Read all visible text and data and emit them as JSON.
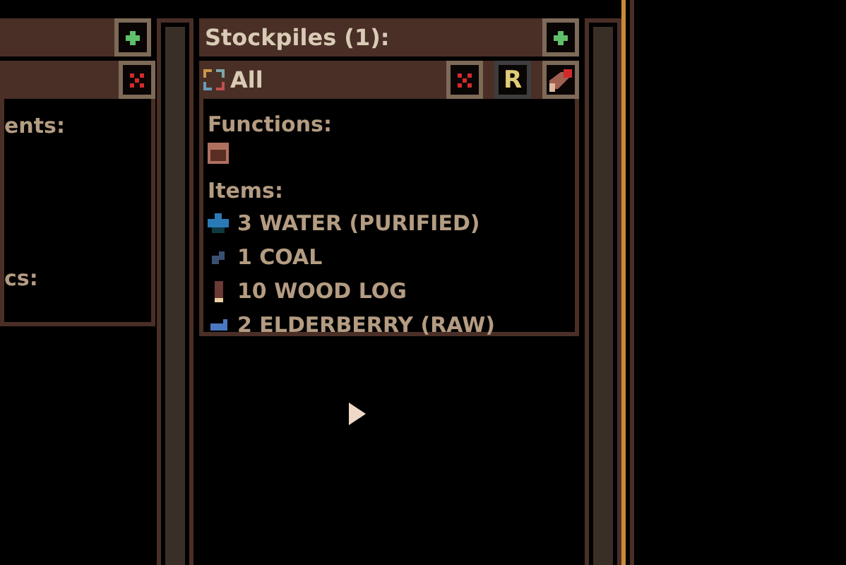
{
  "left_panel": {
    "header_button": {
      "kind": "add"
    },
    "sub_button": {
      "kind": "delete"
    },
    "labels": [
      "ents:",
      "cs:"
    ]
  },
  "stockpiles": {
    "title": "Stockpiles (1):",
    "header_button": {
      "kind": "add"
    },
    "stockpile": {
      "name": "All",
      "buttons": [
        {
          "kind": "delete"
        },
        {
          "kind": "rename",
          "label": "R"
        },
        {
          "kind": "paint"
        }
      ],
      "functions_label": "Functions:",
      "items_label": "Items:",
      "items": [
        {
          "kind": "water",
          "text": "3 WATER (PURIFIED)"
        },
        {
          "kind": "coal",
          "text": "1 COAL"
        },
        {
          "kind": "log",
          "text": "10 WOOD LOG"
        },
        {
          "kind": "berry",
          "text": "2 ELDERBERRY (RAW)"
        }
      ]
    }
  }
}
